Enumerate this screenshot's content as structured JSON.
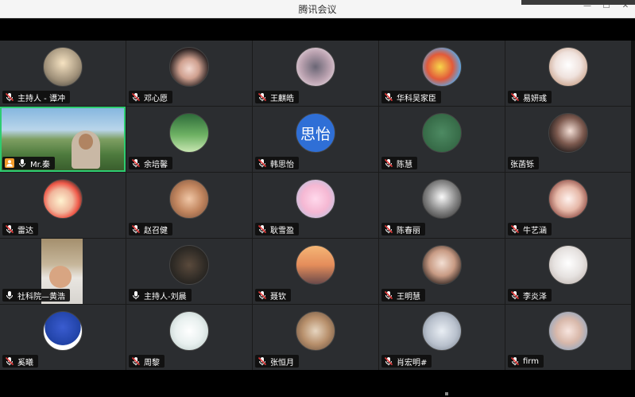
{
  "window": {
    "title": "腾讯会议",
    "controls": [
      "—",
      "☐",
      "✕"
    ]
  },
  "colors": {
    "tile_bg": "#2b2d30",
    "active_border": "#2ecc71",
    "muted_mic": "#e23b3b",
    "label_bg": "#0f0f0f"
  },
  "participants": [
    {
      "name": "主持人 - 谭冲",
      "mic": "muted",
      "avatar": "photo-pier"
    },
    {
      "name": "邓心愿",
      "mic": "muted",
      "avatar": "photo-girl"
    },
    {
      "name": "王麒皓",
      "mic": "muted",
      "avatar": "photo-cartoon"
    },
    {
      "name": "华科吴家臣",
      "mic": "muted",
      "avatar": "photo-shinchan"
    },
    {
      "name": "易妍彧",
      "mic": "muted",
      "avatar": "photo-cat"
    },
    {
      "name": "Mr.秦",
      "mic": "on",
      "avatar": "video",
      "active": true,
      "host_icon": "person-icon"
    },
    {
      "name": "余培馨",
      "mic": "muted",
      "avatar": "photo-green"
    },
    {
      "name": "韩思怡",
      "mic": "muted",
      "avatar": "text",
      "avatar_text": "思怡"
    },
    {
      "name": "陈慧",
      "mic": "muted",
      "avatar": "photo-green-text"
    },
    {
      "name": "张菡铄",
      "mic": "none",
      "avatar": "photo-girl2"
    },
    {
      "name": "雷达",
      "mic": "muted",
      "avatar": "photo-shinchan2"
    },
    {
      "name": "赵召健",
      "mic": "muted",
      "avatar": "photo-cats"
    },
    {
      "name": "耿雪盈",
      "mic": "muted",
      "avatar": "photo-bunny"
    },
    {
      "name": "陈春丽",
      "mic": "muted",
      "avatar": "photo-bw"
    },
    {
      "name": "牛艺涵",
      "mic": "muted",
      "avatar": "photo-girl3"
    },
    {
      "name": "社科院—黄浩",
      "mic": "on",
      "avatar": "video-small"
    },
    {
      "name": "主持人-刘晨",
      "mic": "on",
      "avatar": "photo-guy"
    },
    {
      "name": "聂钦",
      "mic": "muted",
      "avatar": "photo-sunset"
    },
    {
      "name": "王明慧",
      "mic": "muted",
      "avatar": "photo-girl4"
    },
    {
      "name": "李炎泽",
      "mic": "muted",
      "avatar": "photo-kitten"
    },
    {
      "name": "奚曦",
      "mic": "muted",
      "avatar": "photo-kiki"
    },
    {
      "name": "周黎",
      "mic": "muted",
      "avatar": "photo-elephant"
    },
    {
      "name": "张恒月",
      "mic": "muted",
      "avatar": "photo-dog"
    },
    {
      "name": "肖宏明#",
      "mic": "muted",
      "avatar": "photo-runner"
    },
    {
      "name": "firm",
      "mic": "muted",
      "avatar": "photo-girl5"
    }
  ]
}
